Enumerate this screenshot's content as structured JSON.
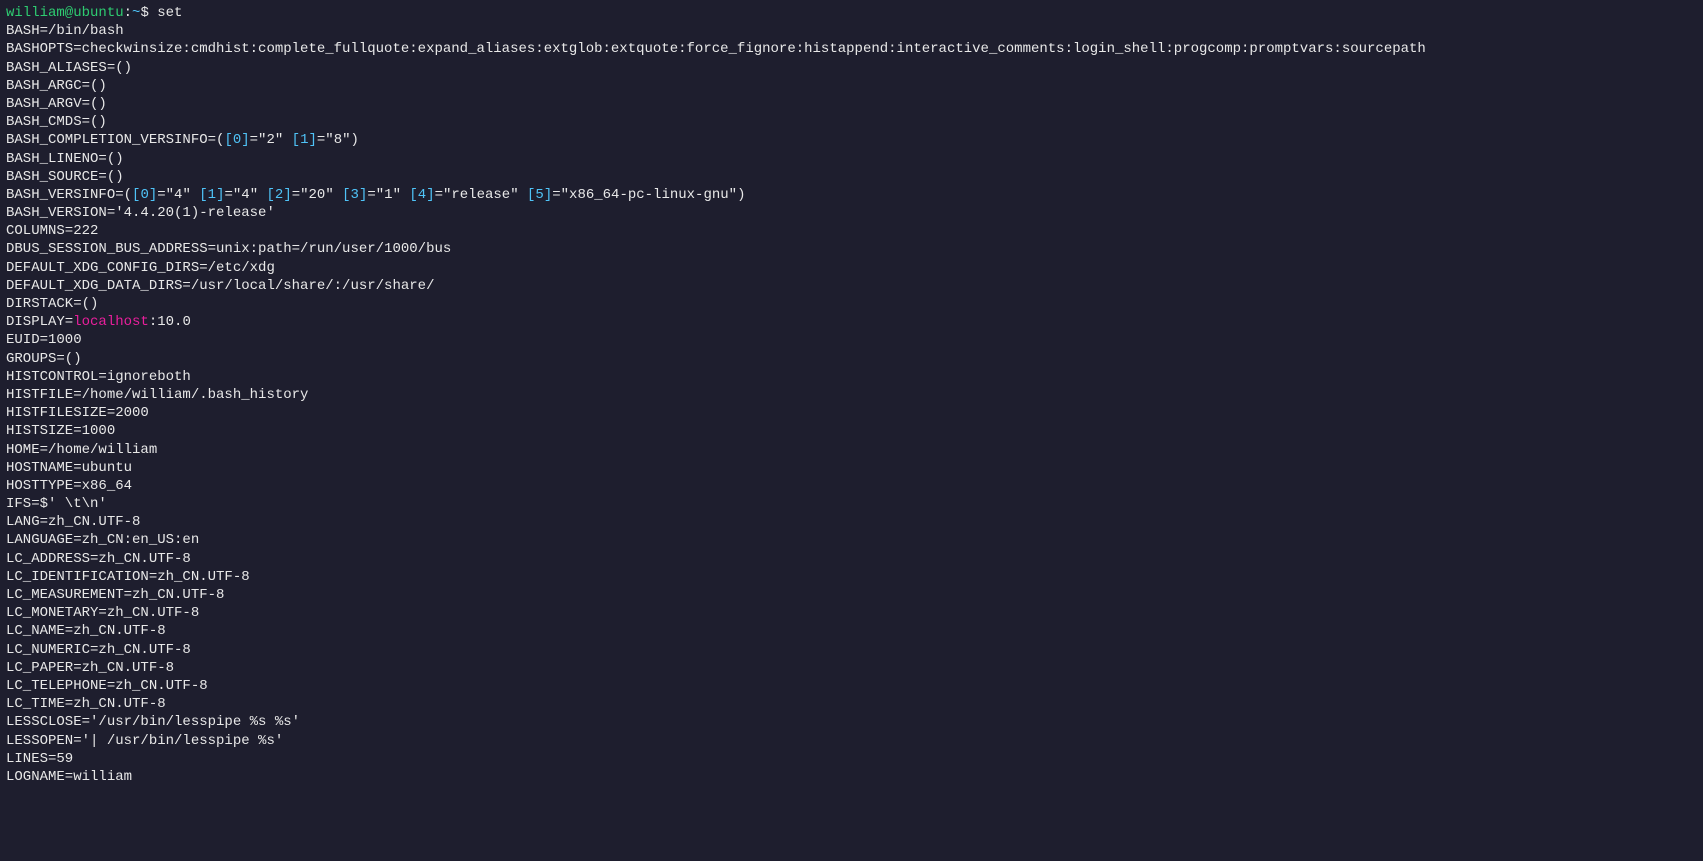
{
  "prompt": {
    "user": "william",
    "host": "ubuntu",
    "path": "~",
    "symbol": "$",
    "command": "set"
  },
  "lines": [
    {
      "type": "plain",
      "text": "BASH=/bin/bash"
    },
    {
      "type": "plain",
      "text": "BASHOPTS=checkwinsize:cmdhist:complete_fullquote:expand_aliases:extglob:extquote:force_fignore:histappend:interactive_comments:login_shell:progcomp:promptvars:sourcepath"
    },
    {
      "type": "plain",
      "text": "BASH_ALIASES=()"
    },
    {
      "type": "plain",
      "text": "BASH_ARGC=()"
    },
    {
      "type": "plain",
      "text": "BASH_ARGV=()"
    },
    {
      "type": "plain",
      "text": "BASH_CMDS=()"
    },
    {
      "type": "bash_comp",
      "prefix": "BASH_COMPLETION_VERSINFO=(",
      "entries": [
        {
          "idx": "0",
          "val": "\"2\""
        },
        {
          "idx": "1",
          "val": "\"8\""
        }
      ],
      "suffix": ")"
    },
    {
      "type": "plain",
      "text": "BASH_LINENO=()"
    },
    {
      "type": "plain",
      "text": "BASH_SOURCE=()"
    },
    {
      "type": "bash_vers",
      "prefix": "BASH_VERSINFO=(",
      "entries": [
        {
          "idx": "0",
          "val": "\"4\""
        },
        {
          "idx": "1",
          "val": "\"4\""
        },
        {
          "idx": "2",
          "val": "\"20\""
        },
        {
          "idx": "3",
          "val": "\"1\""
        },
        {
          "idx": "4",
          "val": "\"release\""
        },
        {
          "idx": "5",
          "val": "\"x86_64-pc-linux-gnu\""
        }
      ],
      "suffix": ")"
    },
    {
      "type": "plain",
      "text": "BASH_VERSION='4.4.20(1)-release'"
    },
    {
      "type": "plain",
      "text": "COLUMNS=222"
    },
    {
      "type": "plain",
      "text": "DBUS_SESSION_BUS_ADDRESS=unix:path=/run/user/1000/bus"
    },
    {
      "type": "plain",
      "text": "DEFAULT_XDG_CONFIG_DIRS=/etc/xdg"
    },
    {
      "type": "plain",
      "text": "DEFAULT_XDG_DATA_DIRS=/usr/local/share/:/usr/share/"
    },
    {
      "type": "plain",
      "text": "DIRSTACK=()"
    },
    {
      "type": "display",
      "prefix": "DISPLAY=",
      "host": "localhost",
      "rest": ":10.0"
    },
    {
      "type": "plain",
      "text": "EUID=1000"
    },
    {
      "type": "plain",
      "text": "GROUPS=()"
    },
    {
      "type": "plain",
      "text": "HISTCONTROL=ignoreboth"
    },
    {
      "type": "plain",
      "text": "HISTFILE=/home/william/.bash_history"
    },
    {
      "type": "plain",
      "text": "HISTFILESIZE=2000"
    },
    {
      "type": "plain",
      "text": "HISTSIZE=1000"
    },
    {
      "type": "plain",
      "text": "HOME=/home/william"
    },
    {
      "type": "plain",
      "text": "HOSTNAME=ubuntu"
    },
    {
      "type": "plain",
      "text": "HOSTTYPE=x86_64"
    },
    {
      "type": "plain",
      "text": "IFS=$' \\t\\n'"
    },
    {
      "type": "plain",
      "text": "LANG=zh_CN.UTF-8"
    },
    {
      "type": "plain",
      "text": "LANGUAGE=zh_CN:en_US:en"
    },
    {
      "type": "plain",
      "text": "LC_ADDRESS=zh_CN.UTF-8"
    },
    {
      "type": "plain",
      "text": "LC_IDENTIFICATION=zh_CN.UTF-8"
    },
    {
      "type": "plain",
      "text": "LC_MEASUREMENT=zh_CN.UTF-8"
    },
    {
      "type": "plain",
      "text": "LC_MONETARY=zh_CN.UTF-8"
    },
    {
      "type": "plain",
      "text": "LC_NAME=zh_CN.UTF-8"
    },
    {
      "type": "plain",
      "text": "LC_NUMERIC=zh_CN.UTF-8"
    },
    {
      "type": "plain",
      "text": "LC_PAPER=zh_CN.UTF-8"
    },
    {
      "type": "plain",
      "text": "LC_TELEPHONE=zh_CN.UTF-8"
    },
    {
      "type": "plain",
      "text": "LC_TIME=zh_CN.UTF-8"
    },
    {
      "type": "plain",
      "text": "LESSCLOSE='/usr/bin/lesspipe %s %s'"
    },
    {
      "type": "plain",
      "text": "LESSOPEN='| /usr/bin/lesspipe %s'"
    },
    {
      "type": "plain",
      "text": "LINES=59"
    },
    {
      "type": "plain",
      "text": "LOGNAME=william"
    }
  ]
}
